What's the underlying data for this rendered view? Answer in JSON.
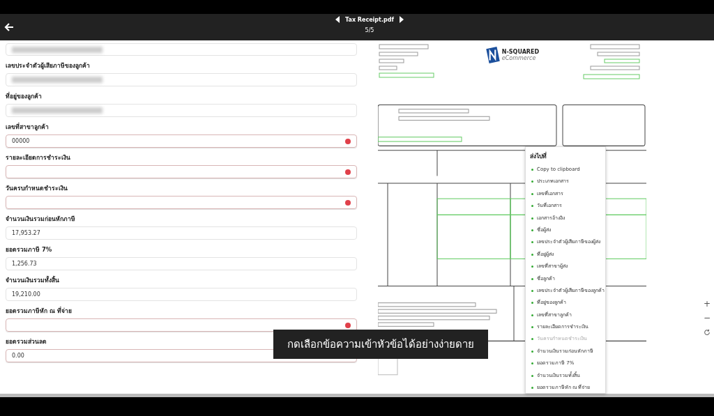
{
  "top_bar": {
    "title": "Tax Receipt.pdf",
    "page": "5/5"
  },
  "form": {
    "fields": [
      {
        "redacted": true,
        "error": false
      },
      {
        "label": "เลขประจำตัวผู้เสียภาษีของลูกค้า",
        "redacted": true,
        "error": false
      },
      {
        "label": "ที่อยู่ของลูกค้า",
        "redacted": true,
        "error": false
      },
      {
        "label": "เลขที่สาขาลูกค้า",
        "value": "00000",
        "redacted": false,
        "error": true
      },
      {
        "label": "รายละเอียดการชำระเงิน",
        "redacted": false,
        "error": true
      },
      {
        "label": "วันครบกำหนดชำระเงิน",
        "redacted": false,
        "error": true
      },
      {
        "label": "จำนวนเงินรวมก่อนหักภาษี",
        "value": "17,953.27",
        "redacted": false,
        "error": false
      },
      {
        "label": "ยอดรวมภาษี 7%",
        "value": "1,256.73",
        "redacted": false,
        "error": false
      },
      {
        "label": "จำนวนเงินรวมทั้งสิ้น",
        "value": "19,210.00",
        "redacted": false,
        "error": false
      },
      {
        "label": "ยอดรวมภาษีหัก ณ ที่จ่าย",
        "redacted": false,
        "error": true
      },
      {
        "label": "ยอดรวมส่วนลด",
        "value": "0.00",
        "redacted": false,
        "error": true
      }
    ]
  },
  "document": {
    "logo": "N-SQUARED",
    "logo_sub": "eCommerce"
  },
  "context_menu": {
    "title": "ส่งไปที่",
    "items": [
      {
        "label": "Copy to clipboard",
        "selected": false
      },
      {
        "label": "ประเภทเอกสาร",
        "selected": false
      },
      {
        "label": "เลขที่เอกสาร",
        "selected": false
      },
      {
        "label": "วันที่เอกสาร",
        "selected": false
      },
      {
        "label": "เอกสารอ้างอิง",
        "selected": false
      },
      {
        "label": "ชื่อผู้ส่ง",
        "selected": false
      },
      {
        "label": "เลขประจำตัวผู้เสียภาษีของผู้ส่ง",
        "selected": false
      },
      {
        "label": "ที่อยู่ผู้ส่ง",
        "selected": false
      },
      {
        "label": "เลขที่สาขาผู้ส่ง",
        "selected": false
      },
      {
        "label": "ชื่อลูกค้า",
        "selected": false
      },
      {
        "label": "เลขประจำตัวผู้เสียภาษีของลูกค้า",
        "selected": false
      },
      {
        "label": "ที่อยู่ของลูกค้า",
        "selected": false
      },
      {
        "label": "เลขที่สาขาลูกค้า",
        "selected": false
      },
      {
        "label": "รายละเอียดการชำระเงิน",
        "selected": false
      },
      {
        "label": "วันครบกำหนดชำระเงิน",
        "selected": true
      },
      {
        "label": "จำนวนเงินรวมก่อนหักภาษี",
        "selected": false
      },
      {
        "label": "ยอดรวมภาษี 7%",
        "selected": false
      },
      {
        "label": "จำนวนเงินรวมทั้งสิ้น",
        "selected": false
      },
      {
        "label": "ยอดรวมภาษีหัก ณ ที่จ่าย",
        "selected": false
      }
    ]
  },
  "zoom_controls": {
    "zoom_in": "+",
    "zoom_out": "−"
  },
  "caption": "กดเลือกข้อความเข้าหัวข้อได้อย่างง่ายดาย"
}
